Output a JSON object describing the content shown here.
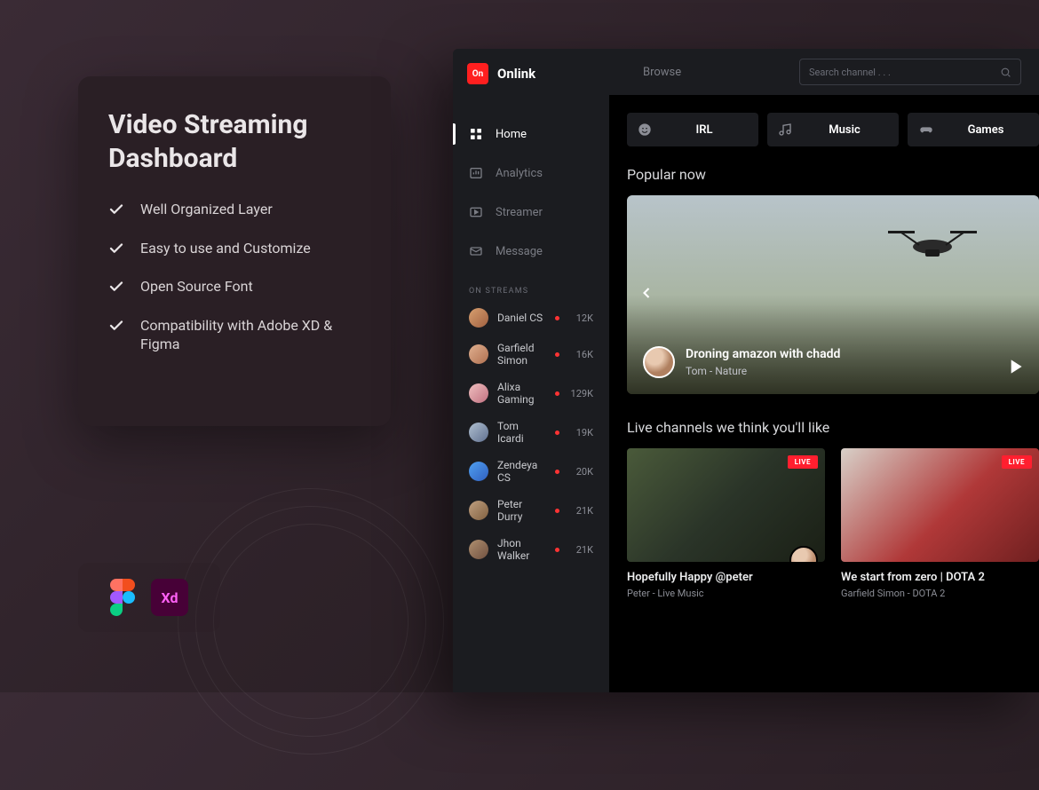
{
  "promo": {
    "title": "Video Streaming Dashboard",
    "features": [
      "Well Organized Layer",
      "Easy to use and Customize",
      "Open Source Font",
      "Compatibility with Adobe XD & Figma"
    ]
  },
  "brand": {
    "mark": "On",
    "name": "Onlink"
  },
  "topbar": {
    "browse": "Browse",
    "search_placeholder": "Search channel . . ."
  },
  "nav": [
    {
      "label": "Home",
      "active": true
    },
    {
      "label": "Analytics",
      "active": false
    },
    {
      "label": "Streamer",
      "active": false
    },
    {
      "label": "Message",
      "active": false
    }
  ],
  "on_streams_label": "ON STREAMS",
  "streams": [
    {
      "name": "Daniel CS",
      "count": "12K",
      "avatar": "linear-gradient(135deg,#d8a070,#a06040)"
    },
    {
      "name": "Garfield Simon",
      "count": "16K",
      "avatar": "linear-gradient(135deg,#e0b090,#b07050)"
    },
    {
      "name": "Alixa Gaming",
      "count": "129K",
      "avatar": "linear-gradient(135deg,#f0c0c0,#c07080)"
    },
    {
      "name": "Tom Icardi",
      "count": "19K",
      "avatar": "linear-gradient(135deg,#b0c0d0,#607090)"
    },
    {
      "name": "Zendeya CS",
      "count": "20K",
      "avatar": "linear-gradient(135deg,#50a0f0,#3060c0)"
    },
    {
      "name": "Peter Durry",
      "count": "21K",
      "avatar": "linear-gradient(135deg,#c0a080,#806040)"
    },
    {
      "name": "Jhon Walker",
      "count": "21K",
      "avatar": "linear-gradient(135deg,#b09070,#705040)"
    }
  ],
  "pills": [
    {
      "label": "IRL",
      "icon": "face"
    },
    {
      "label": "Music",
      "icon": "music"
    },
    {
      "label": "Games",
      "icon": "gamepad"
    }
  ],
  "sections": {
    "popular": "Popular now",
    "live": "Live channels we think you'll like"
  },
  "hero": {
    "title": "Droning amazon with chadd",
    "sub": "Tom - Nature"
  },
  "live_badge": "LIVE",
  "channels": [
    {
      "title": "Hopefully Happy @peter",
      "sub": "Peter - Live Music"
    },
    {
      "title": "We start from zero | DOTA 2",
      "sub": "Garfield Simon - DOTA 2"
    }
  ],
  "xd_text": "Xd"
}
